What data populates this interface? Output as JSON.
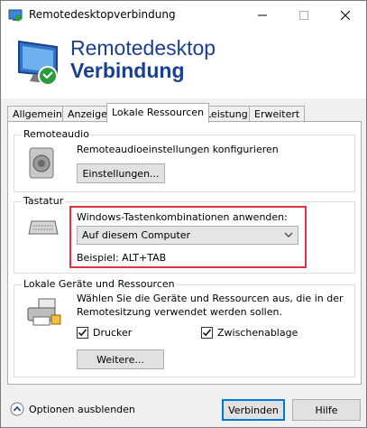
{
  "window": {
    "title": "Remotedesktopverbindung"
  },
  "header": {
    "line1": "Remotedesktop",
    "line2": "Verbindung"
  },
  "tabs": [
    {
      "label": "Allgemein"
    },
    {
      "label": "Anzeige"
    },
    {
      "label": "Lokale Ressourcen"
    },
    {
      "label": "Leistung"
    },
    {
      "label": "Erweitert"
    }
  ],
  "remoteaudio": {
    "legend": "Remoteaudio",
    "description": "Remoteaudioeinstellungen konfigurieren",
    "settings_button": "Einstellungen..."
  },
  "tastatur": {
    "legend": "Tastatur",
    "label": "Windows-Tastenkombinationen anwenden:",
    "selected": "Auf diesem Computer",
    "example": "Beispiel: ALT+TAB"
  },
  "devices": {
    "legend": "Lokale Geräte und Ressourcen",
    "description_line1": "Wählen Sie die Geräte und Ressourcen aus, die in der",
    "description_line2": "Remotesitzung verwendet werden sollen.",
    "printer_label": "Drucker",
    "printer_checked": true,
    "clipboard_label": "Zwischenablage",
    "clipboard_checked": true,
    "more_button": "Weitere..."
  },
  "footer": {
    "options_label": "Optionen ausblenden",
    "connect_button": "Verbinden",
    "help_button": "Hilfe"
  },
  "colors": {
    "accent": "#0078d7",
    "highlight": "#d9363e",
    "brand": "#1b3f8f"
  }
}
